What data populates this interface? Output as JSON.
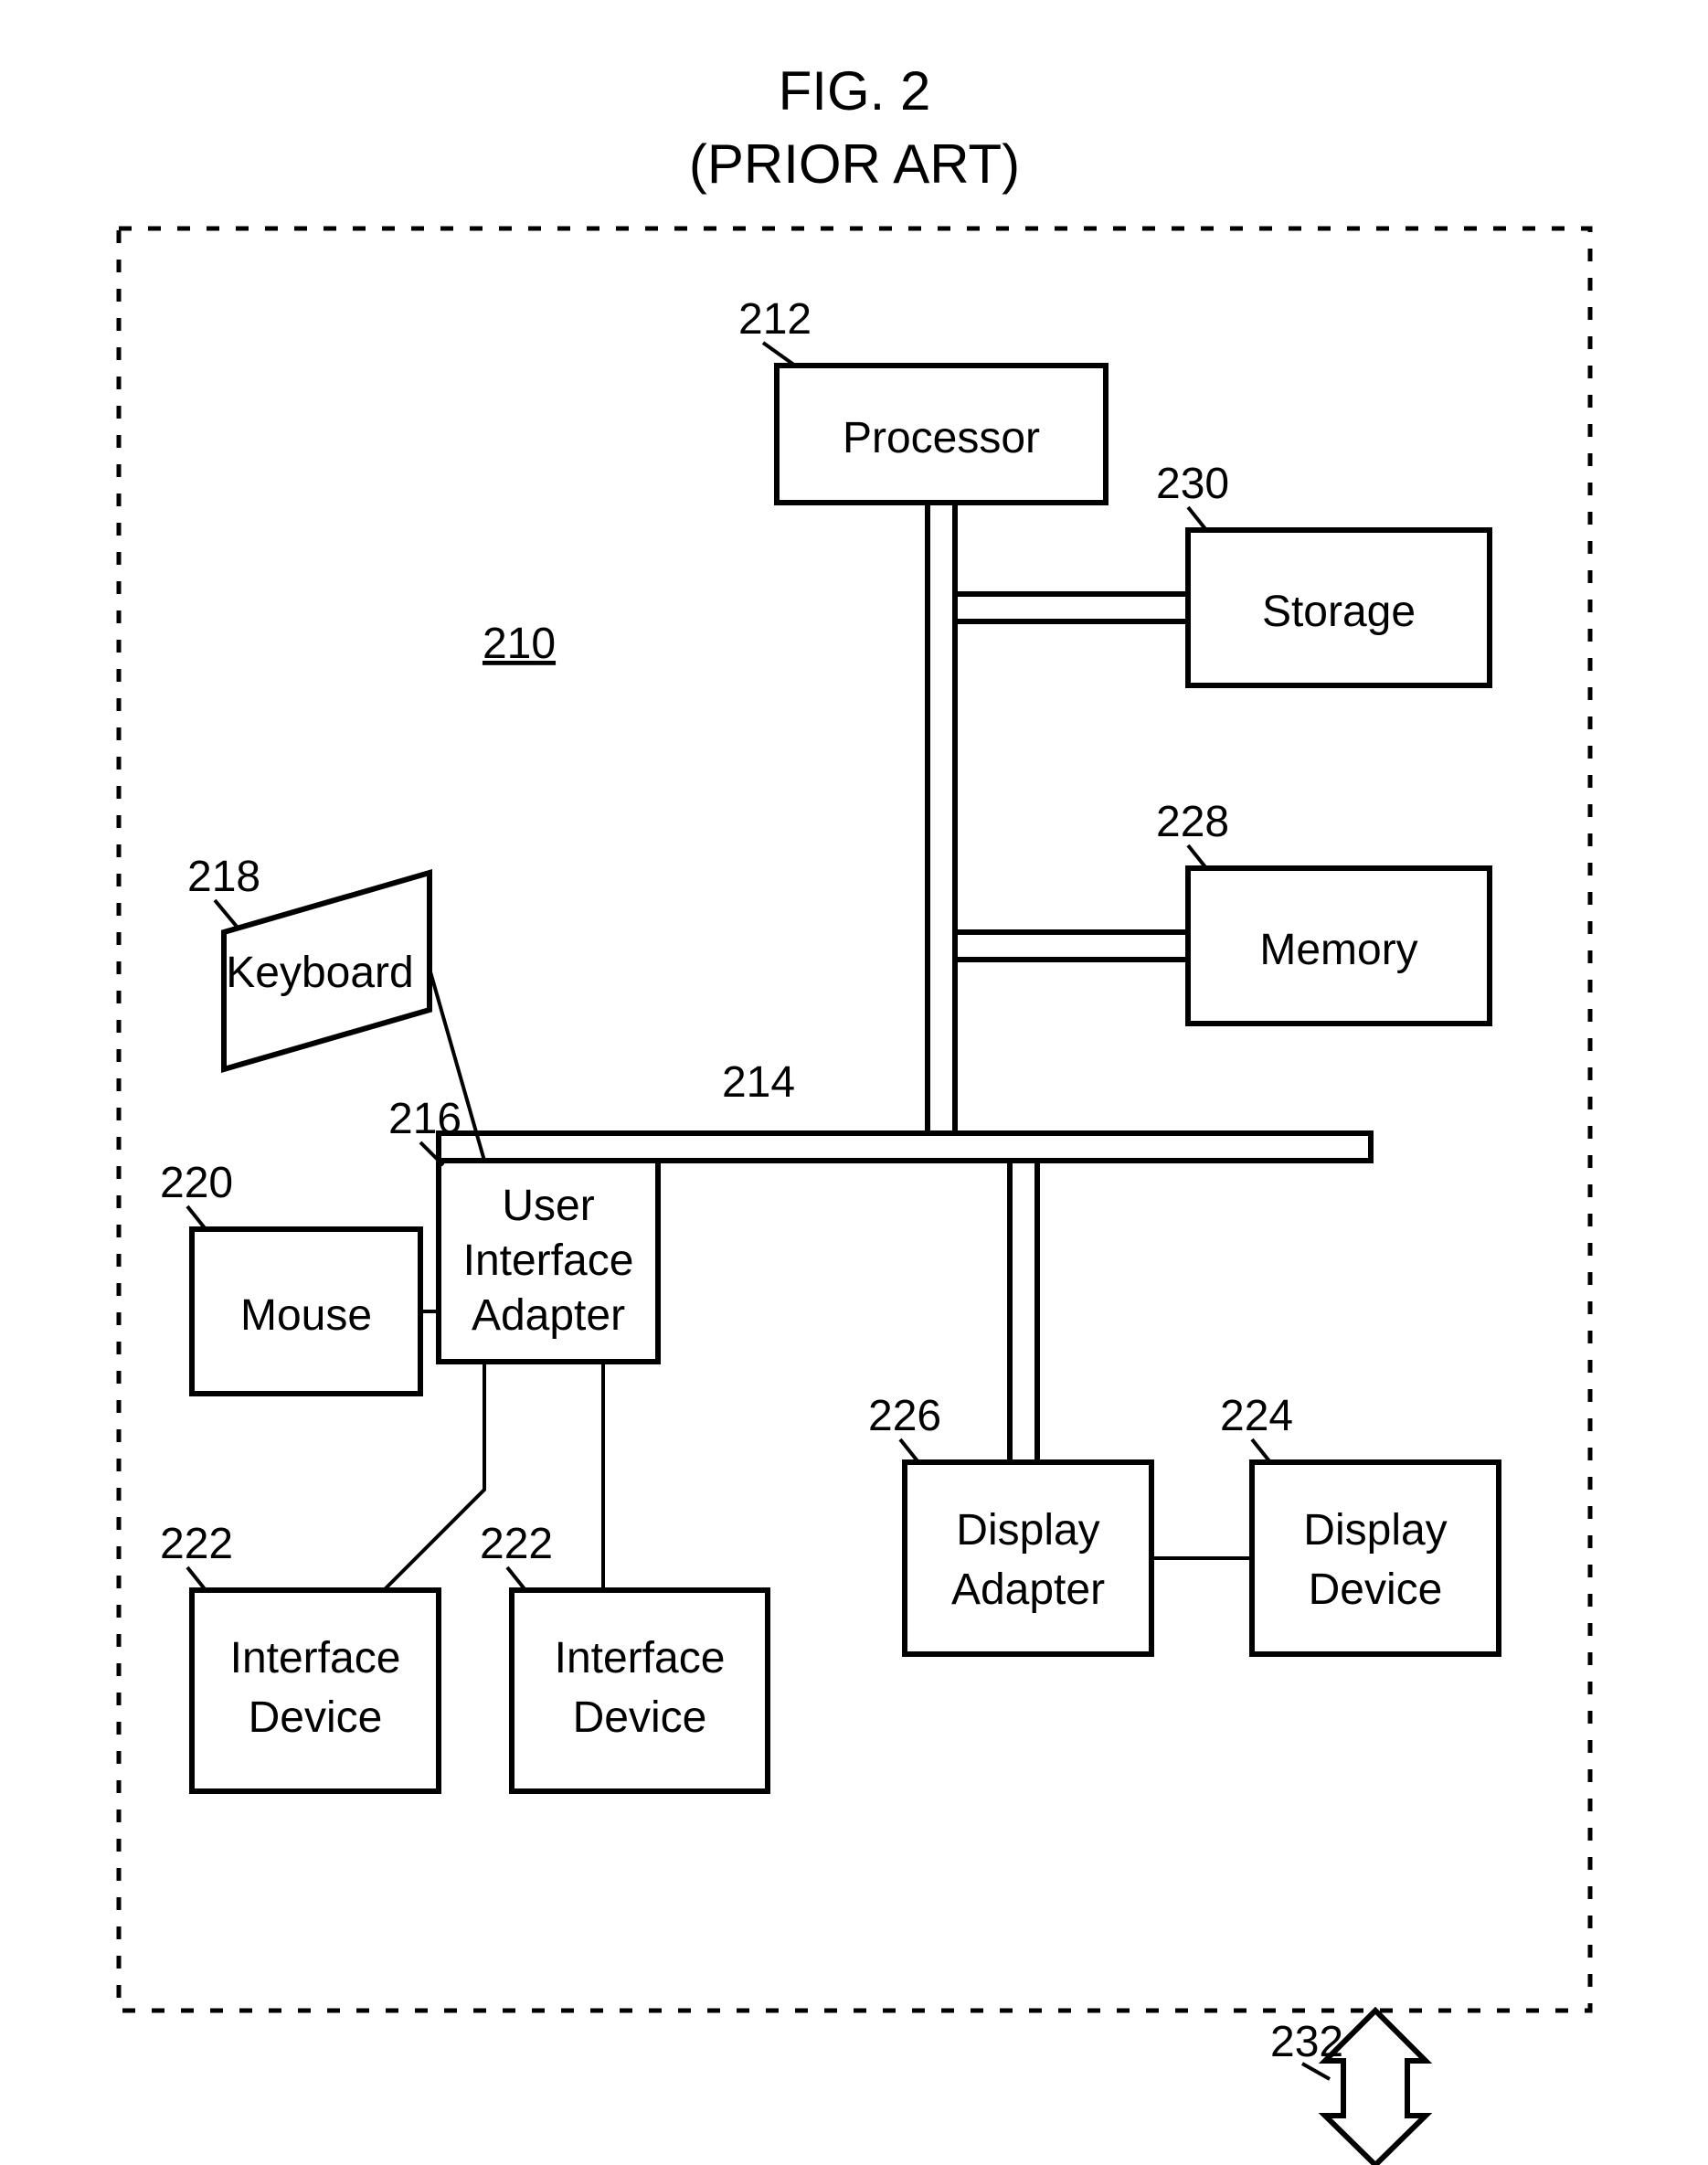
{
  "figure": {
    "title_line1": "FIG. 2",
    "title_line2": "(PRIOR ART)",
    "system_ref": "210",
    "external_ref": "232",
    "blocks": {
      "processor": {
        "label": "Processor",
        "ref": "212"
      },
      "bus": {
        "ref": "214"
      },
      "user_if_adapter": {
        "label": "User\nInterface\nAdapter",
        "ref": "216"
      },
      "keyboard": {
        "label": "Keyboard",
        "ref": "218"
      },
      "mouse": {
        "label": "Mouse",
        "ref": "220"
      },
      "interface_dev_a": {
        "label": "Interface\nDevice",
        "ref": "222"
      },
      "interface_dev_b": {
        "label": "Interface\nDevice",
        "ref": "222"
      },
      "display_device": {
        "label": "Display\nDevice",
        "ref": "224"
      },
      "display_adapter": {
        "label": "Display\nAdapter",
        "ref": "226"
      },
      "memory": {
        "label": "Memory",
        "ref": "228"
      },
      "storage": {
        "label": "Storage",
        "ref": "230"
      }
    }
  }
}
